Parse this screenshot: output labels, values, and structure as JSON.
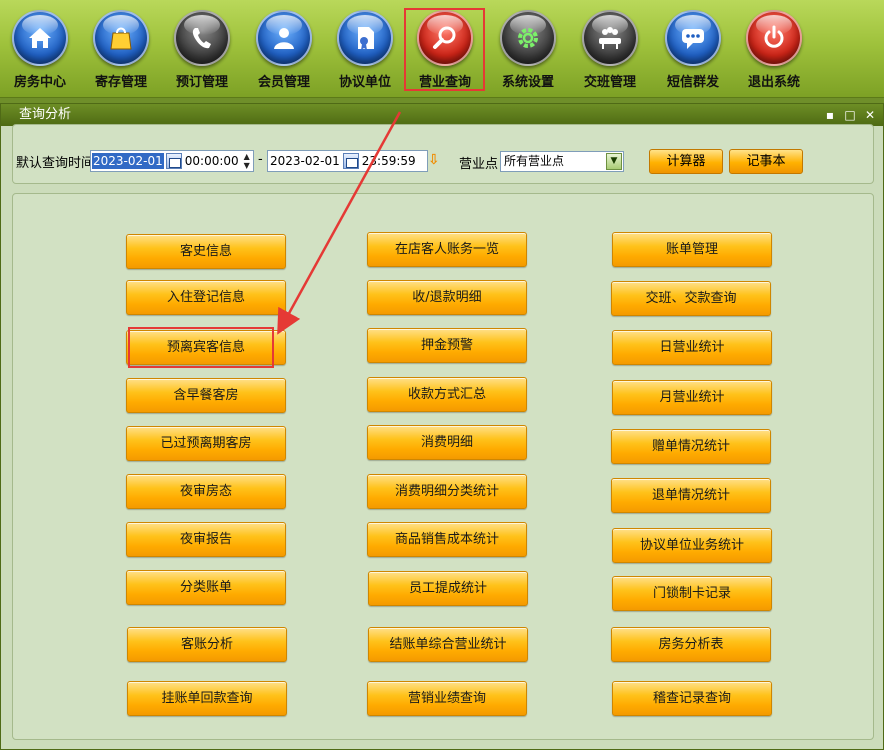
{
  "toolbar": {
    "items": [
      {
        "label": "房务中心",
        "icon": "home-icon"
      },
      {
        "label": "寄存管理",
        "icon": "bag-icon"
      },
      {
        "label": "预订管理",
        "icon": "phone-icon"
      },
      {
        "label": "会员管理",
        "icon": "user-icon"
      },
      {
        "label": "协议单位",
        "icon": "document-icon"
      },
      {
        "label": "营业查询",
        "icon": "magnifier-icon"
      },
      {
        "label": "系统设置",
        "icon": "gear-icon"
      },
      {
        "label": "交班管理",
        "icon": "meeting-icon"
      },
      {
        "label": "短信群发",
        "icon": "sms-icon"
      },
      {
        "label": "退出系统",
        "icon": "power-icon"
      }
    ]
  },
  "panel": {
    "title": "查询分析",
    "window_buttons": [
      "▪",
      "□",
      "✕"
    ]
  },
  "query": {
    "label": "默认查询时间",
    "start_date": "2023-02-01",
    "start_time": "00:00:00",
    "separator": "-",
    "end_date": "2023-02-01",
    "end_time": "23:59:59",
    "shop_label": "营业点",
    "shop_value": "所有营业点",
    "calculator_label": "计算器",
    "notepad_label": "记事本"
  },
  "buttons": {
    "col1": [
      "客史信息",
      "入住登记信息",
      "预离宾客信息",
      "含早餐客房",
      "已过预离期客房",
      "夜审房态",
      "夜审报告",
      "分类账单",
      "客账分析",
      "挂账单回款查询"
    ],
    "col2": [
      "在店客人账务一览",
      "收/退款明细",
      "押金预警",
      "收款方式汇总",
      "消费明细",
      "消费明细分类统计",
      "商品销售成本统计",
      "员工提成统计",
      "结账单综合营业统计",
      "营销业绩查询"
    ],
    "col3": [
      "账单管理",
      "交班、交款查询",
      "日营业统计",
      "月营业统计",
      "赠单情况统计",
      "退单情况统计",
      "协议单位业务统计",
      "门锁制卡记录",
      "房务分析表",
      "稽查记录查询"
    ]
  },
  "colors": {
    "accent_orange": "#ffb100",
    "highlight_red": "#e53935",
    "toolbar_green": "#9fc23c"
  }
}
